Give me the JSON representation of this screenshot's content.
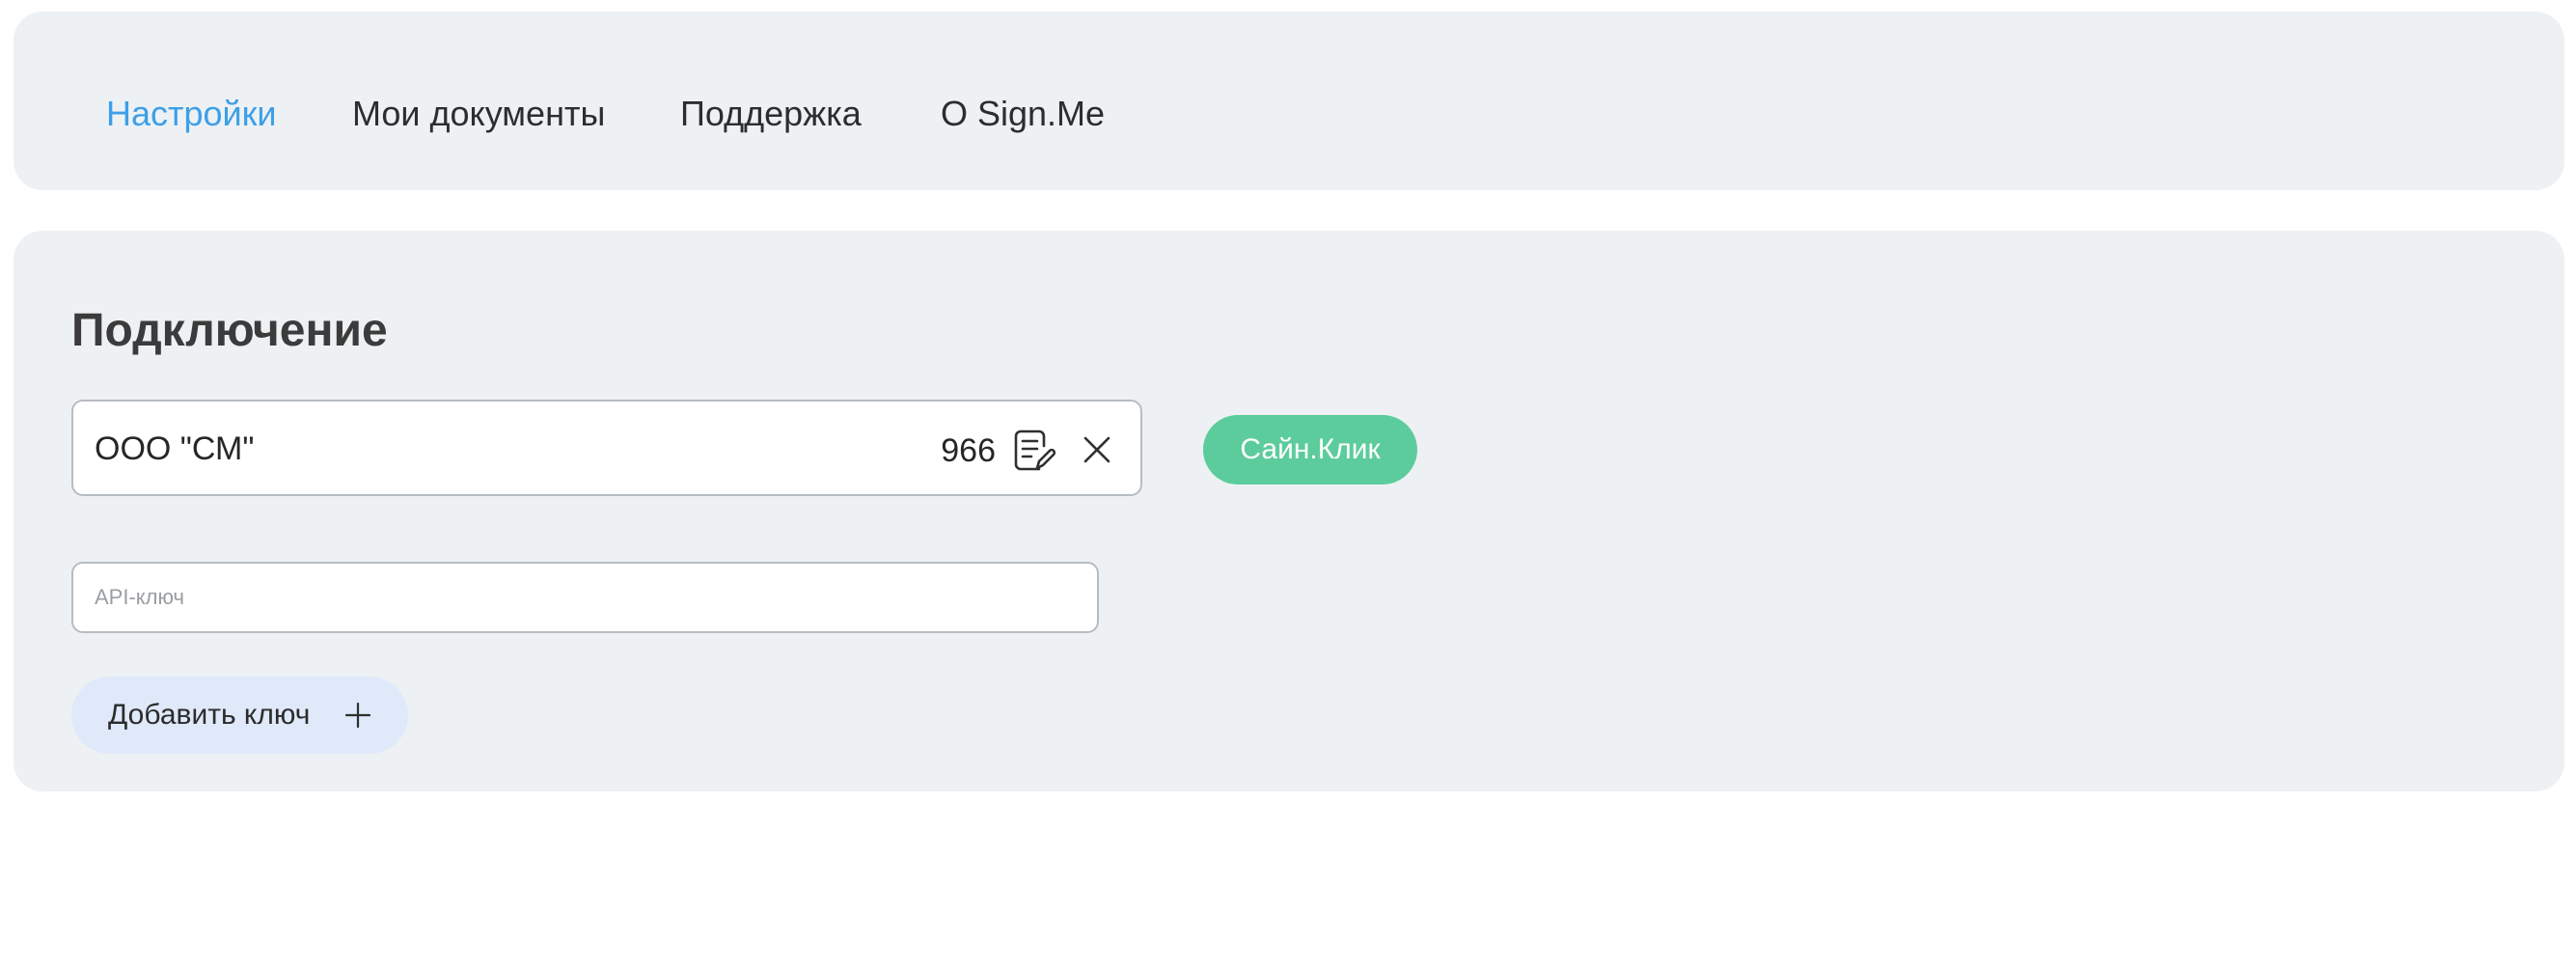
{
  "nav": {
    "items": [
      {
        "label": "Настройки",
        "active": true
      },
      {
        "label": "Мои документы",
        "active": false
      },
      {
        "label": "Поддержка",
        "active": false
      },
      {
        "label": "О Sign.Me",
        "active": false
      }
    ]
  },
  "connection": {
    "title": "Подключение",
    "org_name": "ООО \"СМ\"",
    "count": "966",
    "sign_button_label": "Сайн.Клик",
    "api_key": {
      "value": "",
      "placeholder": "API-ключ"
    },
    "add_key_label": "Добавить ключ"
  },
  "icons": {
    "edit": "document-edit-icon",
    "close": "close-icon",
    "add": "plus-icon"
  },
  "colors": {
    "panel_bg": "#edf1f4",
    "nav_active": "#3d9fe7",
    "nav_text": "#2d2d2d",
    "sign_button_bg": "#5ccc9c",
    "add_button_bg": "#dfe9f9",
    "field_border": "#b7bcc2"
  }
}
